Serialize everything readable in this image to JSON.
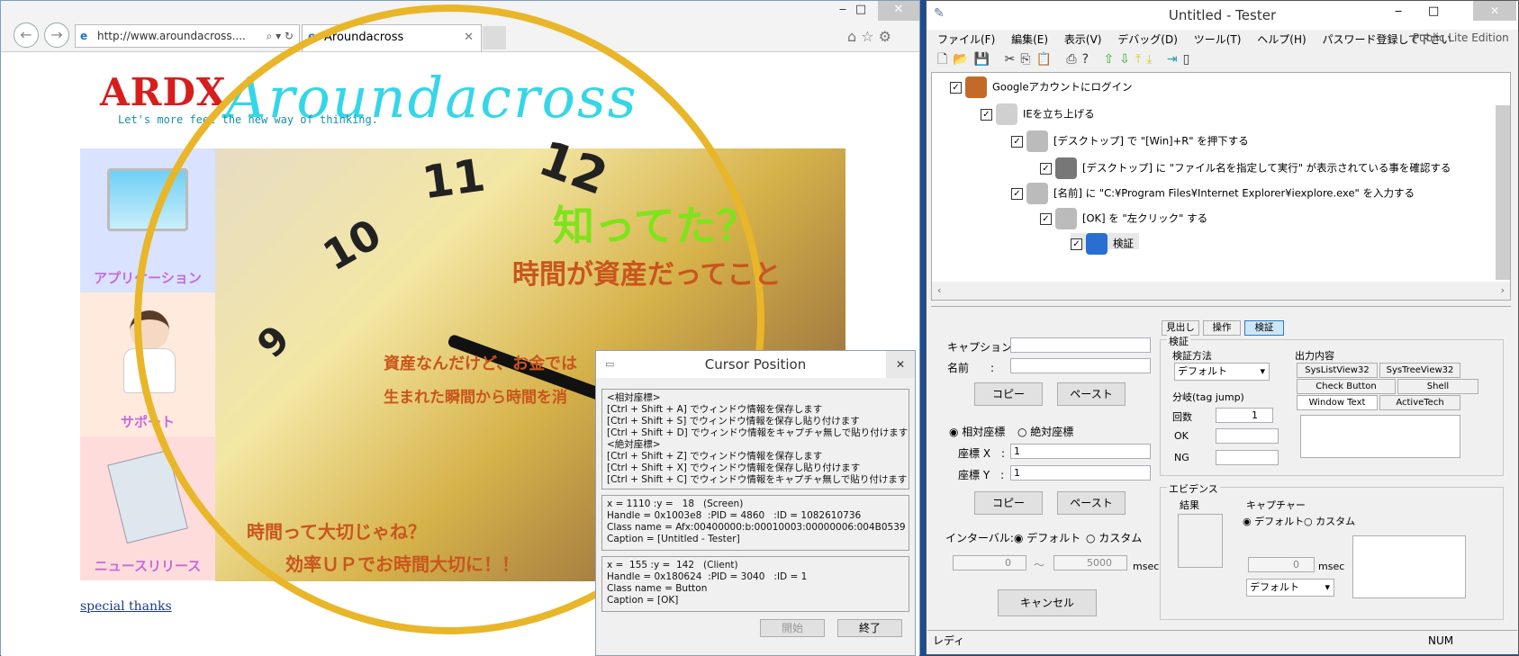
{
  "ie": {
    "address": "http://www.aroundacross....",
    "tab_title": "Aroundacross",
    "win_min": "‒",
    "win_max": "□",
    "win_close": "✕"
  },
  "site": {
    "logo_text": "ARDX",
    "logo_script": "Aroundacross",
    "tagline": "Let's more feel the new way of thinking.",
    "side_items": [
      "アプリケーション",
      "サポート",
      "ニュースリリース"
    ],
    "hero_line1": "知ってた？",
    "hero_line2": "時間が資産だってこと",
    "hero_line3": "資産なんだけど、お金では",
    "hero_line4": "生まれた瞬間から時間を消",
    "hero_line5": "時間って大切じゃね？",
    "hero_line6": "効率ＵＰでお時間大切に！！",
    "clock_12": "12",
    "clock_11": "11",
    "clock_10": "10",
    "clock_9": "9",
    "special_thanks": "special thanks"
  },
  "cursor_dialog": {
    "title": "Cursor Position",
    "info_text": "<相対座標>\n[Ctrl + Shift + A] でウィンドウ情報を保存します\n[Ctrl + Shift + S] でウィンドウ情報を保存し貼り付けます\n[Ctrl + Shift + D] でウィンドウ情報をキャプチャ無しで貼り付けます\n<絶対座標>\n[Ctrl + Shift + Z] でウィンドウ情報を保存します\n[Ctrl + Shift + X] でウィンドウ情報を保存し貼り付けます\n[Ctrl + Shift + C] でウィンドウ情報をキャプチャ無しで貼り付けます",
    "screen_text": "x = 1110 :y =   18   (Screen)\nHandle = 0x1003e8  :PID = 4860   :ID = 1082610736\nClass name = Afx:00400000:b:00010003:00000006:004B0539\nCaption = [Untitled - Tester]",
    "client_text": "x =  155 :y =  142   (Client)\nHandle = 0x180624  :PID = 3040   :ID = 1\nClass name = Button\nCaption = [OK]",
    "start_button": "開始",
    "end_button": "終了",
    "close": "✕"
  },
  "tester": {
    "title": "Untitled - Tester",
    "menu": [
      "ファイル(F)",
      "編集(E)",
      "表示(V)",
      "デバッグ(D)",
      "ツール(T)",
      "ヘルプ(H)",
      "パスワード登録して下さい"
    ],
    "edition": "Public Lite Edition",
    "tree": [
      "Googleアカウントにログイン",
      "IEを立ち上げる",
      "[デスクトップ] で \"[Win]+R\" を押下する",
      "[デスクトップ] に \"ファイル名を指定して実行\" が表示されている事を確認する",
      "[名前] に \"C:¥Program Files¥Internet Explorer¥iexplore.exe\" を入力する",
      "[OK] を \"左クリック\" する",
      "検証"
    ],
    "tabs": [
      "見出し",
      "操作",
      "検証"
    ],
    "caption_label": "キャプション:",
    "name_label": "名前　　:",
    "copy": "コピー",
    "paste": "ペースト",
    "relative": "相対座標",
    "absolute": "絶対座標",
    "coord_x_label": "座標 X　:",
    "coord_y_label": "座標 Y　:",
    "coord_x": "1",
    "coord_y": "1",
    "interval_label": "インターバル:",
    "default": "デフォルト",
    "custom": "カスタム",
    "interval_from": "0",
    "interval_to": "5000",
    "msec": "msec",
    "tilde": "～",
    "cancel": "キャンセル",
    "verify_group": "検証",
    "verify_method": "検証方法",
    "verify_method_value": "デフォルト",
    "branch": "分岐(tag jump)",
    "count_label": "回数",
    "count_value": "1",
    "ok": "OK",
    "ng": "NG",
    "output": "出力内容",
    "output_tabs": [
      "SysListView32",
      "SysTreeView32",
      "Check Button",
      "Shell",
      "Window Text",
      "ActiveTech"
    ],
    "evidence": "エビデンス",
    "result": "結果",
    "capture": "キャプチャー",
    "capture_value": "0",
    "capture_select": "デフォルト",
    "status_ready": "レディ",
    "status_num": "NUM"
  }
}
